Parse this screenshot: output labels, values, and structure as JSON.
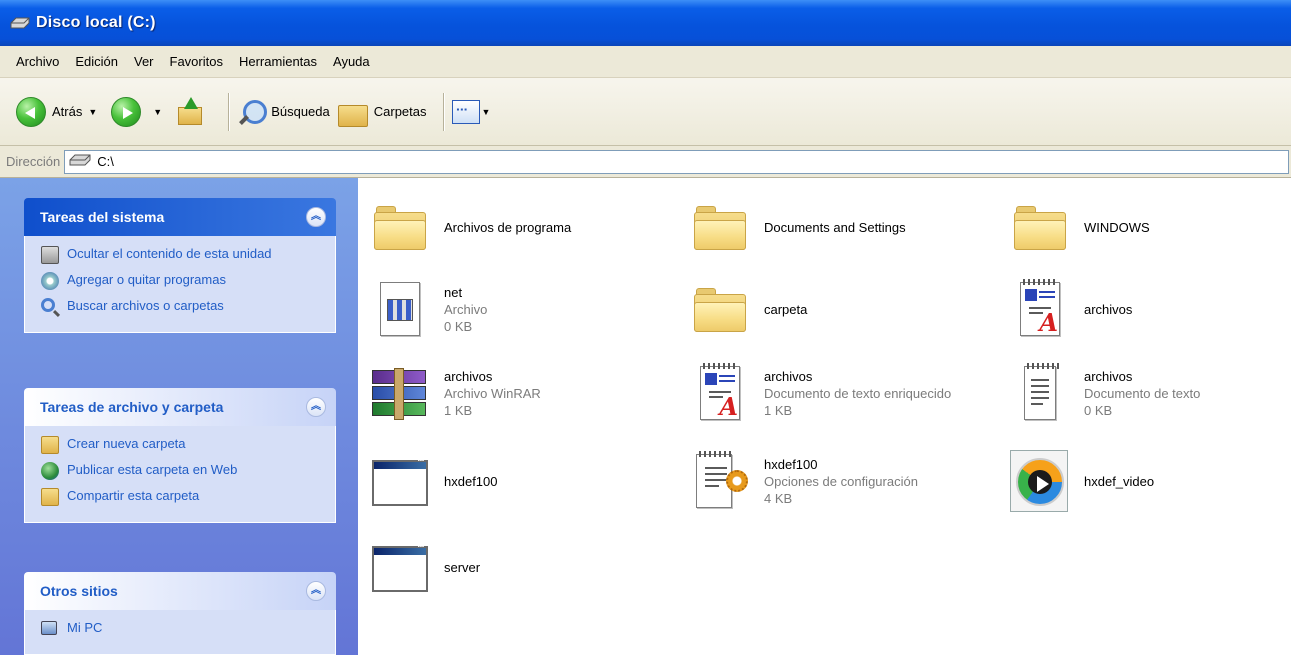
{
  "window": {
    "title": "Disco local (C:)"
  },
  "menu": [
    "Archivo",
    "Edición",
    "Ver",
    "Favoritos",
    "Herramientas",
    "Ayuda"
  ],
  "toolbar": {
    "back": "Atrás",
    "search": "Búsqueda",
    "folders": "Carpetas"
  },
  "address": {
    "label": "Dirección",
    "value": "C:\\"
  },
  "panels": {
    "system": {
      "title": "Tareas del sistema",
      "tasks": [
        "Ocultar el contenido de esta unidad",
        "Agregar o quitar programas",
        "Buscar archivos o carpetas"
      ]
    },
    "files": {
      "title": "Tareas de archivo y carpeta",
      "tasks": [
        "Crear nueva carpeta",
        "Publicar esta carpeta en Web",
        "Compartir esta carpeta"
      ]
    },
    "places": {
      "title": "Otros sitios",
      "tasks": [
        "Mi PC"
      ]
    }
  },
  "items": [
    {
      "name": "Archivos de programa"
    },
    {
      "name": "Documents and Settings"
    },
    {
      "name": "WINDOWS"
    },
    {
      "name": "net",
      "type": "Archivo",
      "size": "0 KB"
    },
    {
      "name": "carpeta"
    },
    {
      "name": "archivos"
    },
    {
      "name": "archivos",
      "type": "Archivo WinRAR",
      "size": "1 KB"
    },
    {
      "name": "archivos",
      "type": "Documento de texto enriquecido",
      "size": "1 KB"
    },
    {
      "name": "archivos",
      "type": "Documento de texto",
      "size": "0 KB"
    },
    {
      "name": "hxdef100"
    },
    {
      "name": "hxdef100",
      "type": "Opciones de configuración",
      "size": "4 KB"
    },
    {
      "name": "hxdef_video"
    },
    {
      "name": "server"
    }
  ],
  "colors": {
    "titlebar": "#0653dc",
    "taskpane": "#7ba2e7",
    "link": "#215dc6"
  }
}
